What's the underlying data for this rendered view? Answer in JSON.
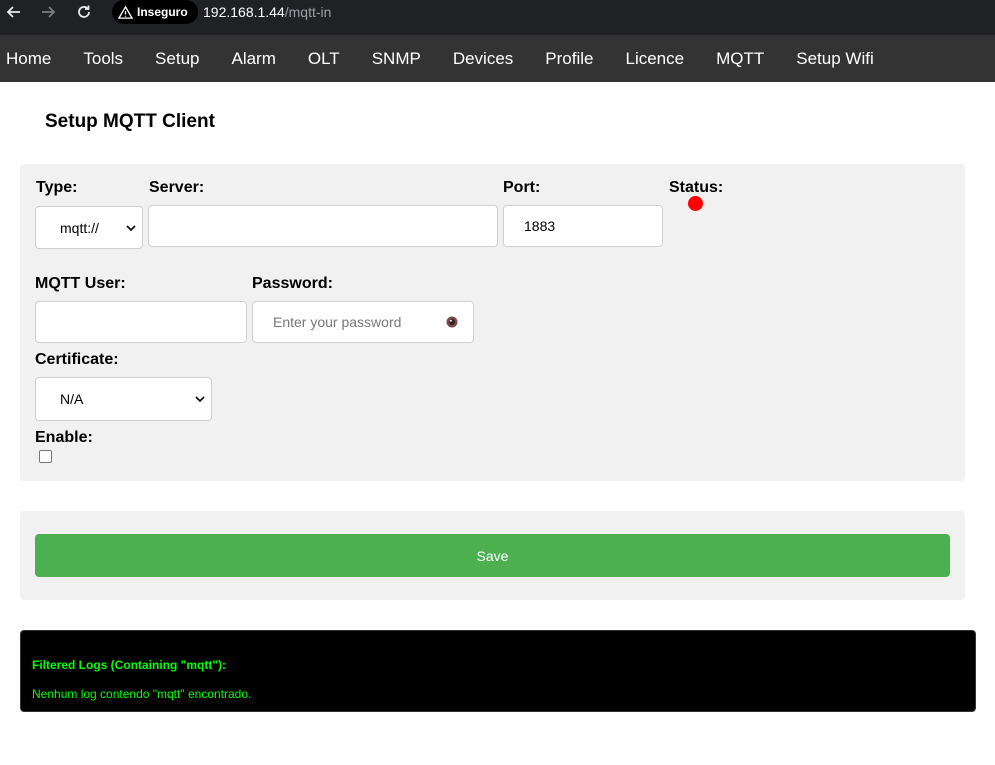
{
  "browser": {
    "security_label": "Inseguro",
    "url_host": "192.168.1.44",
    "url_path": "/mqtt-in"
  },
  "nav": {
    "items": [
      "Home",
      "Tools",
      "Setup",
      "Alarm",
      "OLT",
      "SNMP",
      "Devices",
      "Profile",
      "Licence",
      "MQTT",
      "Setup Wifi"
    ]
  },
  "page": {
    "title": "Setup MQTT Client"
  },
  "form": {
    "type_label": "Type:",
    "type_value": "mqtt://",
    "server_label": "Server:",
    "server_value": "",
    "port_label": "Port:",
    "port_value": "1883",
    "status_label": "Status:",
    "status_color": "#ff0000",
    "user_label": "MQTT User:",
    "user_value": "",
    "password_label": "Password:",
    "password_placeholder": "Enter your password",
    "certificate_label": "Certificate:",
    "certificate_value": "N/A",
    "enable_label": "Enable:",
    "enable_checked": false
  },
  "actions": {
    "save_label": "Save",
    "save_color": "#4caf50"
  },
  "logs": {
    "title": "Filtered Logs (Containing \"mqtt\"):",
    "message": "Nenhum log contendo \"mqtt\" encontrado.",
    "text_color": "#00ff00"
  }
}
